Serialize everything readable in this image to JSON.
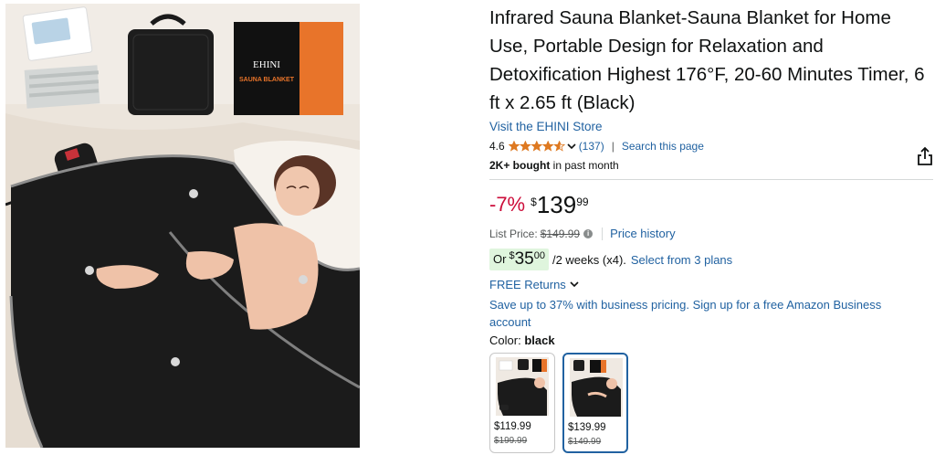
{
  "product": {
    "title": "Infrared Sauna Blanket-Sauna Blanket for Home Use, Portable Design for Relaxation and Detoxification Highest 176°F, 20-60 Minutes Timer, 6 ft x 2.65 ft (Black)",
    "store_link": "Visit the EHINI Store",
    "image_brand_text": "EHINI",
    "image_box_text": "SAUNA BLANKET"
  },
  "rating": {
    "value": "4.6",
    "stars": 4.6,
    "count": "(137)",
    "search_link": "Search this page"
  },
  "bought": {
    "strong": "2K+ bought",
    "rest": "in past month"
  },
  "price": {
    "discount": "-7%",
    "currency": "$",
    "whole": "139",
    "fraction": "99",
    "list_label": "List Price:",
    "list_price": "$149.99",
    "history_link": "Price history"
  },
  "plan": {
    "or_label": "Or",
    "currency": "$",
    "whole": "35",
    "fraction": "00",
    "rest": "/2 weeks (x4).",
    "select_link": "Select from 3 plans"
  },
  "returns_label": "FREE Returns",
  "business_text": "Save up to 37% with business pricing. Sign up for a free Amazon Business account",
  "color": {
    "label": "Color:",
    "value": "black"
  },
  "swatches": [
    {
      "price": "$119.99",
      "list_price": "$199.99",
      "selected": false
    },
    {
      "price": "$139.99",
      "list_price": "$149.99",
      "selected": true
    }
  ],
  "colors": {
    "link": "#2162a1",
    "discount": "#cc0c39",
    "star": "#de7921",
    "plan_badge": "#dff5dd",
    "selected_border": "#2162a1"
  }
}
